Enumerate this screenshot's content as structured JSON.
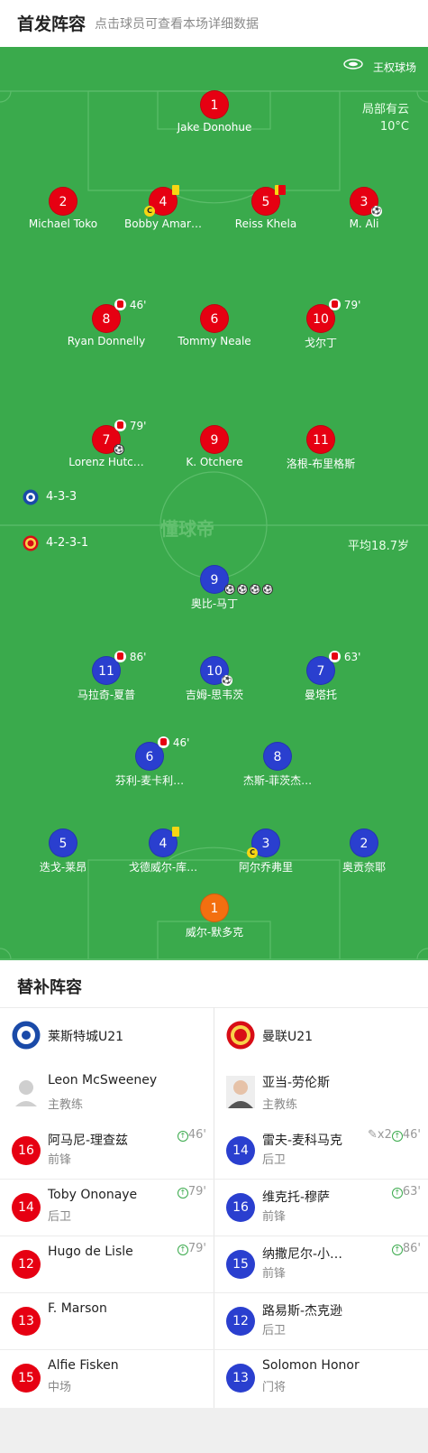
{
  "header": {
    "title": "首发阵容",
    "subtitle": "点击球员可查看本场详细数据"
  },
  "pitch_info": {
    "stadium": "王权球场",
    "weather": "局部有云",
    "temperature": "10°C",
    "watermark": "懂球帝",
    "avg_age": "平均18.7岁"
  },
  "home": {
    "formation": "4-3-3",
    "crest": "leicester-crest-icon"
  },
  "away": {
    "formation": "4-2-3-1",
    "crest": "manutd-crest-icon"
  },
  "home_players": [
    {
      "num": "1",
      "name": "Jake Donohue"
    },
    {
      "num": "2",
      "name": "Michael Toko"
    },
    {
      "num": "4",
      "name": "Bobby Amar…"
    },
    {
      "num": "5",
      "name": "Reiss Khela"
    },
    {
      "num": "3",
      "name": "M. Ali"
    },
    {
      "num": "8",
      "name": "Ryan Donnelly",
      "sub": "46'"
    },
    {
      "num": "6",
      "name": "Tommy Neale"
    },
    {
      "num": "10",
      "name": "戈尔丁",
      "sub": "79'"
    },
    {
      "num": "7",
      "name": "Lorenz Hutc…",
      "sub": "79'"
    },
    {
      "num": "9",
      "name": "K. Otchere"
    },
    {
      "num": "11",
      "name": "洛根-布里格斯"
    }
  ],
  "away_players": [
    {
      "num": "9",
      "name": "奥比-马丁"
    },
    {
      "num": "11",
      "name": "马拉奇-夏普",
      "sub": "86'"
    },
    {
      "num": "10",
      "name": "吉姆-思韦茨"
    },
    {
      "num": "7",
      "name": "曼塔托",
      "sub": "63'"
    },
    {
      "num": "6",
      "name": "芬利-麦卡利…",
      "sub": "46'"
    },
    {
      "num": "8",
      "name": "杰斯-菲茨杰…"
    },
    {
      "num": "5",
      "name": "迭戈-莱昂"
    },
    {
      "num": "4",
      "name": "戈德威尔-库…"
    },
    {
      "num": "3",
      "name": "阿尔乔弗里"
    },
    {
      "num": "2",
      "name": "奥贡奈耶"
    },
    {
      "num": "1",
      "name": "威尔-默多克"
    }
  ],
  "subs_section": {
    "title": "替补阵容",
    "home_team": "莱斯特城U21",
    "away_team": "曼联U21",
    "home_coach": {
      "name": "Leon McSweeney",
      "role": "主教练"
    },
    "away_coach": {
      "name": "亚当-劳伦斯",
      "role": "主教练"
    },
    "home_subs": [
      {
        "num": "16",
        "name": "阿马尼-理查兹",
        "pos": "前锋",
        "time": "46'"
      },
      {
        "num": "14",
        "name": "Toby Ononaye",
        "pos": "后卫",
        "time": "79'"
      },
      {
        "num": "12",
        "name": "Hugo de Lisle",
        "pos": "",
        "time": "79'"
      },
      {
        "num": "13",
        "name": "F. Marson",
        "pos": "",
        "time": ""
      },
      {
        "num": "15",
        "name": "Alfie Fisken",
        "pos": "中场",
        "time": ""
      }
    ],
    "away_subs": [
      {
        "num": "14",
        "name": "雷夫-麦科马克",
        "pos": "后卫",
        "time": "46'",
        "extra": "x2"
      },
      {
        "num": "16",
        "name": "维克托-穆萨",
        "pos": "前锋",
        "time": "63'"
      },
      {
        "num": "15",
        "name": "纳撒尼尔-小…",
        "pos": "前锋",
        "time": "86'"
      },
      {
        "num": "12",
        "name": "路易斯-杰克逊",
        "pos": "后卫",
        "time": ""
      },
      {
        "num": "13",
        "name": "Solomon Honor",
        "pos": "门将",
        "time": ""
      }
    ]
  },
  "colors": {
    "pitch": "#3aaa4c",
    "home": "#e60012",
    "away": "#2a3fcf",
    "keeper_away": "#f36f10"
  }
}
